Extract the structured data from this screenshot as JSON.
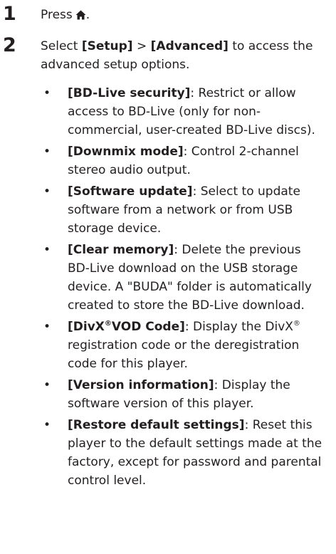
{
  "steps": [
    {
      "number": "1",
      "text": "Press",
      "icon": "home-icon"
    },
    {
      "number": "2",
      "pre": "Select ",
      "setup": "[Setup]",
      "arrow": " > ",
      "advanced": "[Advanced]",
      "post": " to access the advanced setup options."
    }
  ],
  "bullet_char": "•",
  "options": [
    {
      "label": "[BD-Live security]",
      "desc": ": Restrict or allow access to BD-Live (only for non-commercial, user-created BD-Live discs)."
    },
    {
      "label": "[Downmix mode]",
      "desc": ": Control 2-channel stereo audio output."
    },
    {
      "label": "[Software update]",
      "desc": ": Select to update software from a network or from USB storage device."
    },
    {
      "label": "[Clear memory]",
      "desc": ": Delete the previous BD-Live download on the USB storage device. A \"BUDA\" folder is automatically created to store the BD-Live download."
    },
    {
      "label_pre": "[DivX",
      "label_sup": "®",
      "label_post": "VOD Code]",
      "desc_pre": ": Display the DivX",
      "desc_sup": "®",
      "desc_post": " registration code or the deregistration code for this player."
    },
    {
      "label": "[Version information]",
      "desc": ": Display the software version of this player."
    },
    {
      "label": "[Restore default settings]",
      "desc": ": Reset this player to the default settings made at the factory, except for password and parental control level."
    }
  ]
}
